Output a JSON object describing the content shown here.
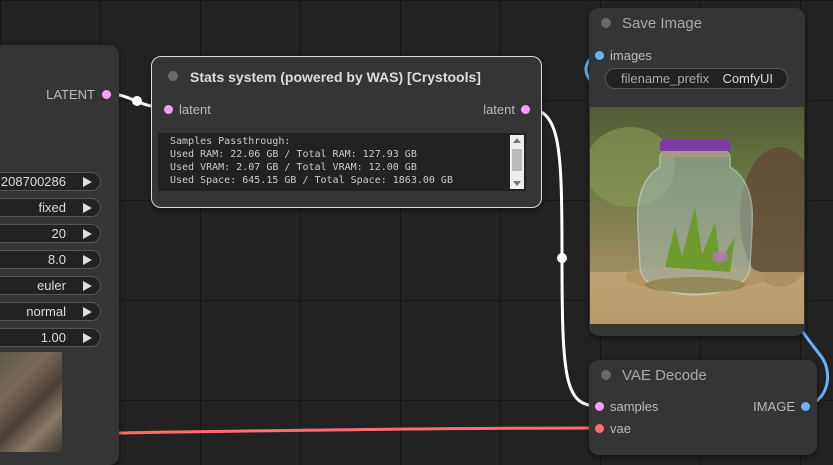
{
  "colors": {
    "latent": "#ff9cf9",
    "image": "#64b5f6",
    "vae": "#ff6e6e",
    "canvas_bg": "#222222",
    "node_bg": "#353535"
  },
  "left_node": {
    "output_label": "LATENT",
    "widgets": [
      {
        "value": "208700286"
      },
      {
        "value": "fixed"
      },
      {
        "value": "20"
      },
      {
        "value": "8.0"
      },
      {
        "value": "euler"
      },
      {
        "value": "normal"
      },
      {
        "value": "1.00"
      }
    ]
  },
  "stats_node": {
    "title": "Stats system (powered by WAS) [Crystools]",
    "input_label": "latent",
    "output_label": "latent",
    "text_lines": [
      "Samples Passthrough:",
      "Used RAM: 22.06 GB / Total RAM: 127.93 GB",
      "Used VRAM: 2.07 GB / Total VRAM: 12.00 GB",
      "Used Space: 645.15 GB / Total Space: 1863.00 GB"
    ]
  },
  "save_node": {
    "title": "Save Image",
    "input_label": "images",
    "widget_name": "filename_prefix",
    "widget_value": "ComfyUI",
    "image_icon": "glass-jar-with-plant-image"
  },
  "vae_node": {
    "title": "VAE Decode",
    "input_samples": "samples",
    "input_vae": "vae",
    "output_label": "IMAGE"
  }
}
